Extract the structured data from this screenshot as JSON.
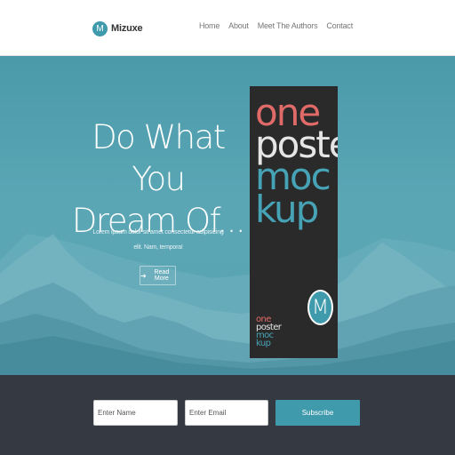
{
  "brand": {
    "logo_letter": "M",
    "name": "Mizuxe"
  },
  "nav": {
    "items": [
      "Home",
      "About",
      "Meet The Authors",
      "Contact"
    ]
  },
  "hero": {
    "title_line1": "Do What You",
    "title_line2": "Dream Of...",
    "description": "Lorem ipsum dolor sit amet consectetur adipisicing elit. Nam, tempora!",
    "read_more_label": "Read More",
    "read_more_icon": "arrow-right-icon"
  },
  "poster": {
    "line1": "one",
    "line2": "poster",
    "line3": "moc",
    "line4": "kup",
    "badge_letter": "M"
  },
  "subscribe": {
    "name_placeholder": "Enter Name",
    "email_placeholder": "Enter Email",
    "button_label": "Subscribe"
  },
  "colors": {
    "accent": "#3f9aac",
    "hero_bg": "#5aa4b3",
    "footer_bg": "#353a42",
    "poster_bg": "#2a2a2a",
    "poster_red": "#e06a68"
  }
}
